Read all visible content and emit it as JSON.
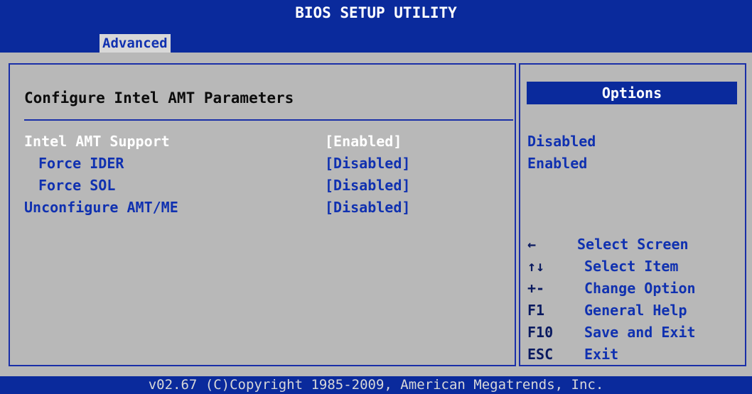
{
  "title": "BIOS SETUP UTILITY",
  "tabs": {
    "active": "Advanced"
  },
  "main": {
    "section_title": "Configure Intel AMT Parameters",
    "settings": [
      {
        "label": "Intel AMT Support",
        "value": "[Enabled]"
      },
      {
        "label": "Force IDER",
        "value": "[Disabled]"
      },
      {
        "label": "Force SOL",
        "value": "[Disabled]"
      },
      {
        "label": "Unconfigure AMT/ME",
        "value": "[Disabled]"
      }
    ]
  },
  "sidebar": {
    "options_title": "Options",
    "options": [
      "Disabled",
      "Enabled"
    ],
    "help": [
      {
        "key": "←",
        "desc": "Select Screen"
      },
      {
        "key": "↑↓",
        "desc": "Select Item"
      },
      {
        "key": "+-",
        "desc": "Change Option"
      },
      {
        "key": "F1",
        "desc": "General Help"
      },
      {
        "key": "F10",
        "desc": "Save and Exit"
      },
      {
        "key": "ESC",
        "desc": "Exit"
      }
    ]
  },
  "footer": "v02.67 (C)Copyright 1985-2009, American Megatrends, Inc.",
  "colors": {
    "background_blue": "#0a2a9c",
    "panel_gray": "#b8b8b8",
    "text_blue": "#1031b0",
    "selected_text": "#ffffff"
  }
}
